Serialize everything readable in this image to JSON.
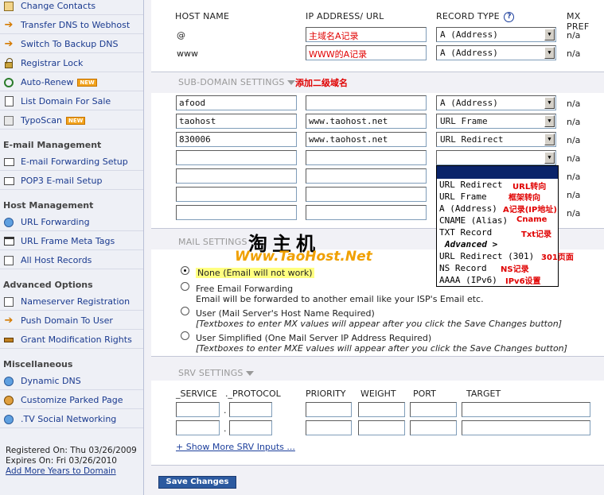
{
  "sidebar": {
    "items_top": [
      {
        "label": "Change Contacts",
        "icon": "contact-icon"
      },
      {
        "label": "Transfer DNS to Webhost",
        "icon": "arrow-icon"
      },
      {
        "label": "Switch To Backup DNS",
        "icon": "arrow-icon"
      },
      {
        "label": "Registrar Lock",
        "icon": "lock-icon"
      },
      {
        "label": "Auto-Renew",
        "icon": "renew-icon",
        "badge": "NEW"
      },
      {
        "label": "List Domain For Sale",
        "icon": "doc-icon"
      },
      {
        "label": "TypoScan",
        "icon": "scan-icon",
        "badge": "NEW"
      }
    ],
    "email_heading": "E-mail Management",
    "email_items": [
      {
        "label": "E-mail Forwarding Setup",
        "icon": "mail-icon"
      },
      {
        "label": "POP3 E-mail Setup",
        "icon": "mail-icon"
      }
    ],
    "host_heading": "Host Management",
    "host_items": [
      {
        "label": "URL Forwarding",
        "icon": "globe-icon"
      },
      {
        "label": "URL Frame Meta Tags",
        "icon": "frame-icon"
      },
      {
        "label": "All Host Records",
        "icon": "list-icon"
      }
    ],
    "advanced_heading": "Advanced Options",
    "advanced_items": [
      {
        "label": "Nameserver Registration",
        "icon": "list-icon"
      },
      {
        "label": "Push Domain To User",
        "icon": "arrow-icon"
      },
      {
        "label": "Grant Modification Rights",
        "icon": "key-icon"
      }
    ],
    "misc_heading": "Miscellaneous",
    "misc_items": [
      {
        "label": "Dynamic DNS",
        "icon": "globe-icon"
      },
      {
        "label": "Customize Parked Page",
        "icon": "gear-icon"
      },
      {
        "label": ".TV Social Networking",
        "icon": "globe-icon"
      }
    ],
    "registered": "Registered On: Thu 03/26/2009",
    "expires": "Expires On: Fri 03/26/2010",
    "add_years": "Add More Years to Domain"
  },
  "host": {
    "col_host": "HOST NAME",
    "col_ip": "IP ADDRESS/ URL",
    "col_type": "RECORD TYPE",
    "col_mx": "MX PREF",
    "help": "?",
    "rows": [
      {
        "host": "@",
        "ip": "主域名A记录",
        "type": "A (Address)",
        "mx": "n/a"
      },
      {
        "host": "www",
        "ip": "WWW的A记录",
        "type": "A (Address)",
        "mx": "n/a"
      }
    ]
  },
  "subdomain": {
    "title": "SUB-DOMAIN SETTINGS",
    "annotation": "添加二级域名",
    "rows": [
      {
        "host": "afood",
        "ip": "",
        "type": "A (Address)",
        "mx": "n/a"
      },
      {
        "host": "taohost",
        "ip": "www.taohost.net",
        "type": "URL Frame",
        "mx": "n/a"
      },
      {
        "host": "830006",
        "ip": "www.taohost.net",
        "type": "URL Redirect",
        "mx": "n/a"
      },
      {
        "host": "",
        "ip": "",
        "type": "",
        "mx": "n/a"
      },
      {
        "host": "",
        "ip": "",
        "type": "",
        "mx": "n/a"
      },
      {
        "host": "",
        "ip": "",
        "type": "",
        "mx": "n/a"
      },
      {
        "host": "",
        "ip": "",
        "type": "",
        "mx": "n/a"
      }
    ]
  },
  "dropdown": {
    "options": [
      {
        "text": "URL Redirect",
        "note": "URL转向"
      },
      {
        "text": "URL Frame",
        "note": "框架转向"
      },
      {
        "text": "A (Address)",
        "note": "A记录(IP地址)"
      },
      {
        "text": "CNAME (Alias)",
        "note": "Cname"
      },
      {
        "text": "TXT Record",
        "note": "Txt记录"
      },
      {
        "text": "Advanced >",
        "note": ""
      },
      {
        "text": "URL Redirect (301)",
        "note": "301页面"
      },
      {
        "text": "NS Record",
        "note": "NS记录"
      },
      {
        "text": "AAAA (IPv6)",
        "note": "IPv6设置"
      }
    ]
  },
  "mail": {
    "title": "MAIL SETTINGS",
    "opt_none": "None (Email will not work)",
    "opt_forward": "Free Email Forwarding",
    "opt_forward_desc": "Email will be forwarded to another email like your ISP's Email etc.",
    "opt_user": "User (Mail Server's Host Name Required)",
    "opt_user_desc": "[Textboxes to enter MX values will appear after you click the Save Changes button]",
    "opt_simple": "User Simplified (One Mail Server IP Address Required)",
    "opt_simple_desc": "[Textboxes to enter MXE values will appear after you click the Save Changes button]"
  },
  "watermark": {
    "cn": "淘主机",
    "en": "Www.TaoHost.Net"
  },
  "srv": {
    "title": "SRV SETTINGS",
    "col_service": "_SERVICE",
    "col_protocol": "._PROTOCOL",
    "col_priority": "PRIORITY",
    "col_weight": "WEIGHT",
    "col_port": "PORT",
    "col_target": "TARGET",
    "dot": ".",
    "show_more": "+ Show More SRV Inputs ..."
  },
  "save_label": "Save Changes"
}
